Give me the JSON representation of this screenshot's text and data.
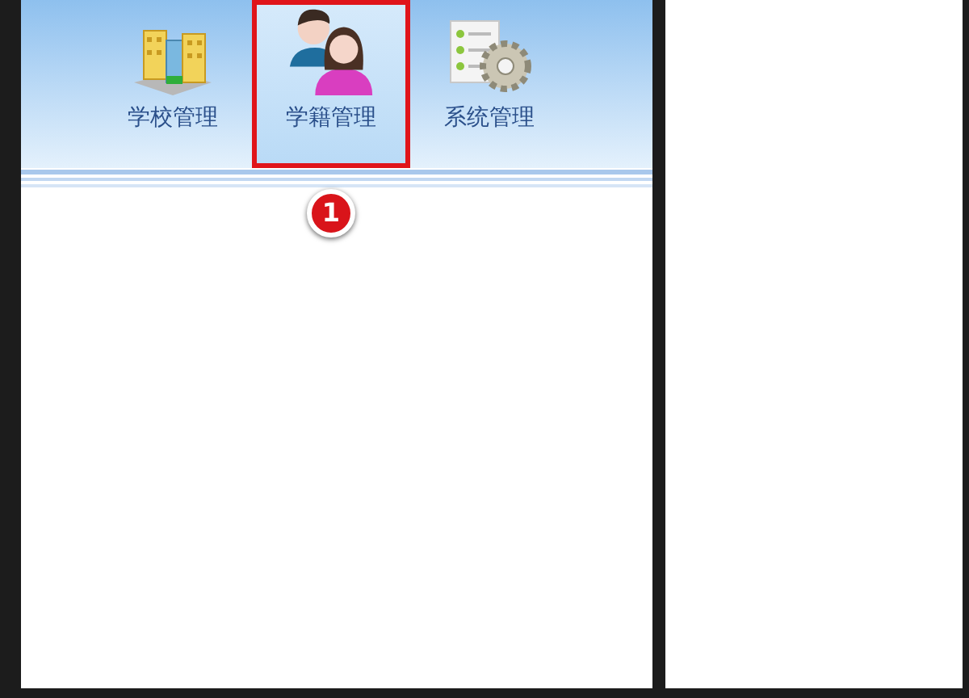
{
  "toolbar": {
    "items": [
      {
        "kind": "school",
        "label": "学校管理",
        "selected": false,
        "annotated": false
      },
      {
        "kind": "students",
        "label": "学籍管理",
        "selected": true,
        "annotated": true
      },
      {
        "kind": "settings",
        "label": "系统管理",
        "selected": false,
        "annotated": false
      }
    ]
  },
  "callout": {
    "number": "1"
  }
}
